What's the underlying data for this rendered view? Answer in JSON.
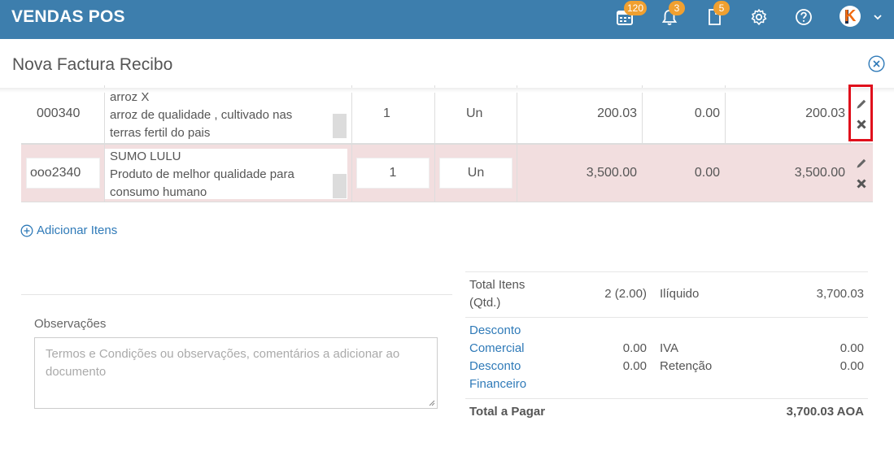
{
  "header": {
    "brand": "VENDAS POS",
    "badges": {
      "calendar": "120",
      "notifications": "3",
      "documents": "5"
    },
    "icons": [
      "calendar-icon",
      "bell-icon",
      "document-icon",
      "gear-icon",
      "help-icon",
      "avatar",
      "chevron-down-icon"
    ]
  },
  "page": {
    "title": "Nova Factura Recibo"
  },
  "items": [
    {
      "code": "000340",
      "name": "arroz X",
      "description_line1": "arroz de qualidade , cultivado nas",
      "description_line2": "terras fertil do pais",
      "qty": "1",
      "unit": "Un",
      "price": "200.03",
      "discount": "0.00",
      "total": "200.03"
    },
    {
      "code": "ooo2340",
      "name": "SUMO LULU",
      "description_line1": "Produto de melhor qualidade para",
      "description_line2": "consumo humano",
      "qty": "1",
      "unit": "Un",
      "price": "3,500.00",
      "discount": "0.00",
      "total": "3,500.00"
    }
  ],
  "add_items_label": "Adicionar Itens",
  "observations": {
    "label": "Observações",
    "placeholder": "Termos e Condições ou observações, comentários a adicionar ao documento"
  },
  "totals": {
    "total_items_label_1": "Total Itens",
    "total_items_label_2": "(Qtd.)",
    "total_items_value": "2 (2.00)",
    "iliquido_label": "Ilíquido",
    "iliquido_value": "3,700.03",
    "desc_comercial_1": "Desconto",
    "desc_comercial_2": "Comercial",
    "desc_comercial_value": "0.00",
    "iva_label": "IVA",
    "iva_value": "0.00",
    "desc_financeiro_1": "Desconto",
    "desc_financeiro_2": "Financeiro",
    "desc_financeiro_value": "0.00",
    "retencao_label": "Retenção",
    "retencao_value": "0.00",
    "total_pagar_label": "Total a Pagar",
    "total_pagar_value": "3,700.03 AOA"
  },
  "colors": {
    "topbar": "#3d7ead",
    "badge": "#f0a030",
    "link": "#2f7ab8",
    "selected_row": "#f2dedf",
    "highlight": "#e0101c"
  }
}
